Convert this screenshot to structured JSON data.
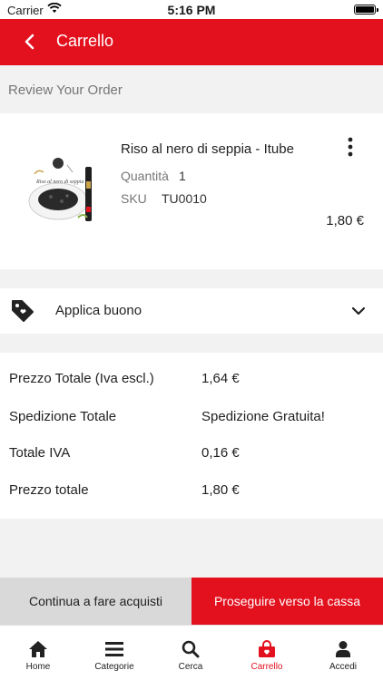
{
  "status_bar": {
    "carrier": "Carrier",
    "time": "5:16 PM"
  },
  "nav": {
    "title": "Carrello"
  },
  "section": {
    "review_title": "Review Your Order"
  },
  "item": {
    "name": "Riso al nero di seppia - Itube",
    "quantity_label": "Quantità",
    "quantity": "1",
    "sku_label": "SKU",
    "sku": "TU0010",
    "price": "1,80 €",
    "thumbnail_caption": "Riso al nero di seppia"
  },
  "coupon": {
    "label": "Applica buono"
  },
  "totals": [
    {
      "label": "Prezzo Totale (Iva escl.)",
      "value": "1,64 €"
    },
    {
      "label": "Spedizione Totale",
      "value": "Spedizione Gratuita!"
    },
    {
      "label": "Totale IVA",
      "value": "0,16 €"
    },
    {
      "label": "Prezzo totale",
      "value": "1,80 €"
    }
  ],
  "actions": {
    "continue_label": "Continua a fare acquisti",
    "checkout_label": "Proseguire verso la cassa"
  },
  "tabs": [
    {
      "label": "Home",
      "icon": "home-icon"
    },
    {
      "label": "Categorie",
      "icon": "menu-icon"
    },
    {
      "label": "Cerca",
      "icon": "search-icon"
    },
    {
      "label": "Carrello",
      "icon": "shopping-bag-icon"
    },
    {
      "label": "Accedi",
      "icon": "user-icon"
    }
  ],
  "colors": {
    "accent": "#e3101e",
    "tab_active": "#e3101e",
    "secondary_button": "#d9d9d9"
  }
}
